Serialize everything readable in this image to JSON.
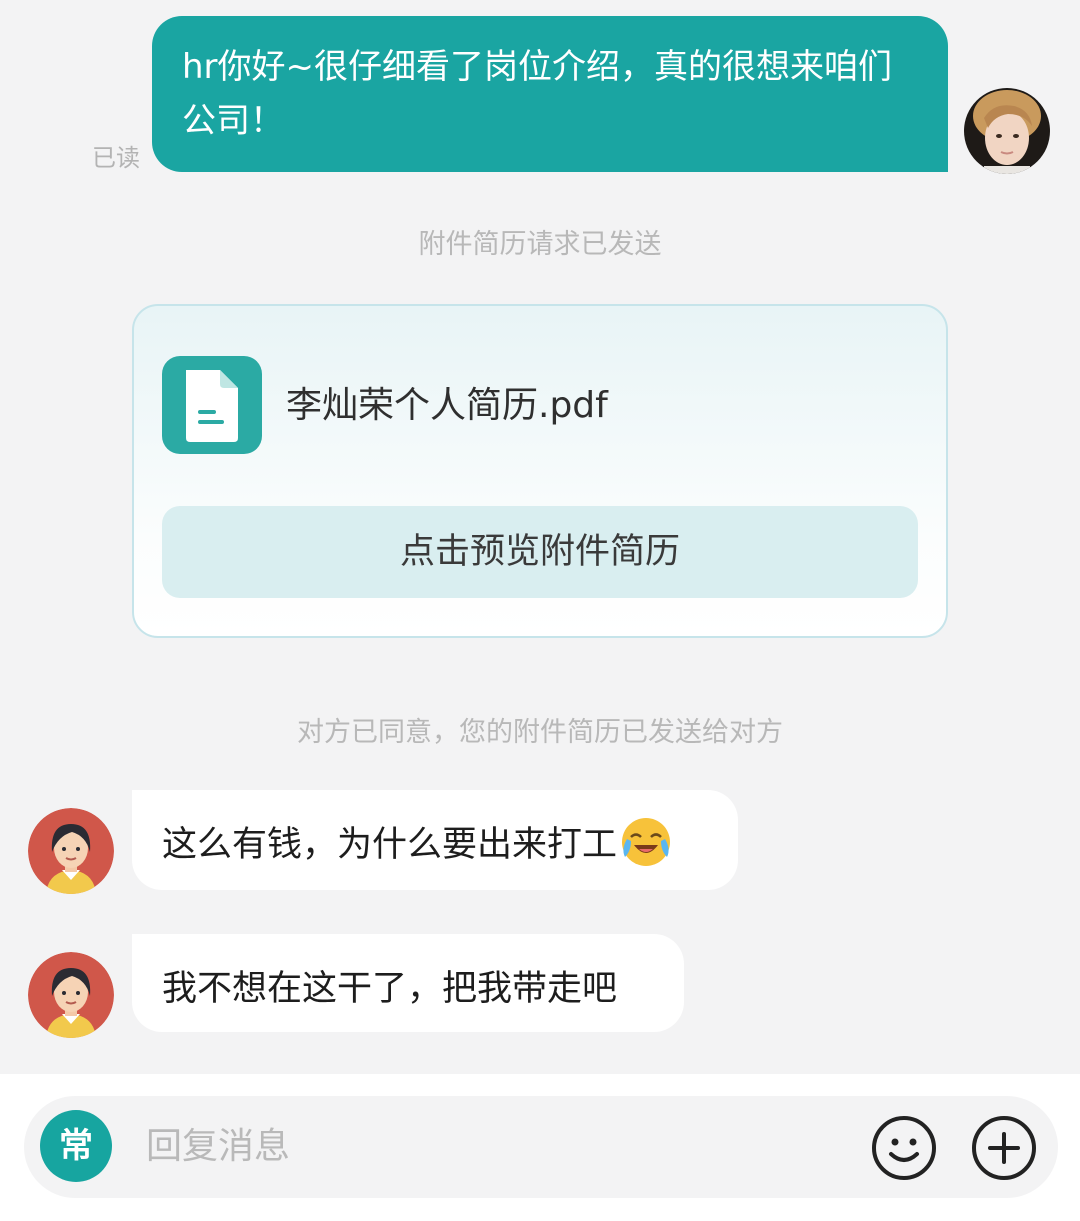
{
  "outgoing_message": {
    "text": "hr你好~很仔细看了岗位介绍，真的很想来咱们公司！",
    "status": "已读"
  },
  "notices": {
    "request_sent": "附件简历请求已发送",
    "agreed_sent": "对方已同意，您的附件简历已发送给对方"
  },
  "resume_card": {
    "file_name": "李灿荣个人简历.pdf",
    "preview_label": "点击预览附件简历",
    "icon": "document-icon",
    "accent": "#2baaa4"
  },
  "incoming_messages": [
    {
      "text": "这么有钱，为什么要出来打工",
      "emoji": "crying-laughing-emoji"
    },
    {
      "text": "我不想在这干了，把我带走吧"
    }
  ],
  "input_bar": {
    "common_phrases_label": "常",
    "placeholder": "回复消息",
    "emoji_icon": "smiley-icon",
    "plus_icon": "plus-circle-icon"
  },
  "colors": {
    "outgoing_bubble": "#1aa5a2",
    "background": "#f3f3f4",
    "incoming_bubble": "#ffffff"
  }
}
